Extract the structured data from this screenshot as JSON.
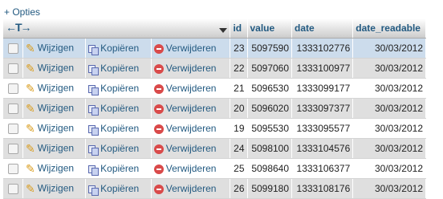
{
  "options_link": "+ Opties",
  "header": {
    "arrows": "←T→",
    "columns": [
      "id",
      "value",
      "date",
      "date_readable"
    ]
  },
  "actions": {
    "edit": "Wijzigen",
    "copy": "Kopiëren",
    "delete": "Verwijderen"
  },
  "rows": [
    {
      "id": "23",
      "value": "5097590",
      "date": "1333102776",
      "date_readable": "30/03/2012",
      "marked": true
    },
    {
      "id": "22",
      "value": "5097060",
      "date": "1333100977",
      "date_readable": "30/03/2012"
    },
    {
      "id": "21",
      "value": "5096530",
      "date": "1333099177",
      "date_readable": "30/03/2012"
    },
    {
      "id": "20",
      "value": "5096020",
      "date": "1333097377",
      "date_readable": "30/03/2012"
    },
    {
      "id": "19",
      "value": "5095530",
      "date": "1333095577",
      "date_readable": "30/03/2012"
    },
    {
      "id": "24",
      "value": "5098100",
      "date": "1333104576",
      "date_readable": "30/03/2012"
    },
    {
      "id": "25",
      "value": "5098640",
      "date": "1333106377",
      "date_readable": "30/03/2012"
    },
    {
      "id": "26",
      "value": "5099180",
      "date": "1333108176",
      "date_readable": "30/03/2012"
    }
  ]
}
